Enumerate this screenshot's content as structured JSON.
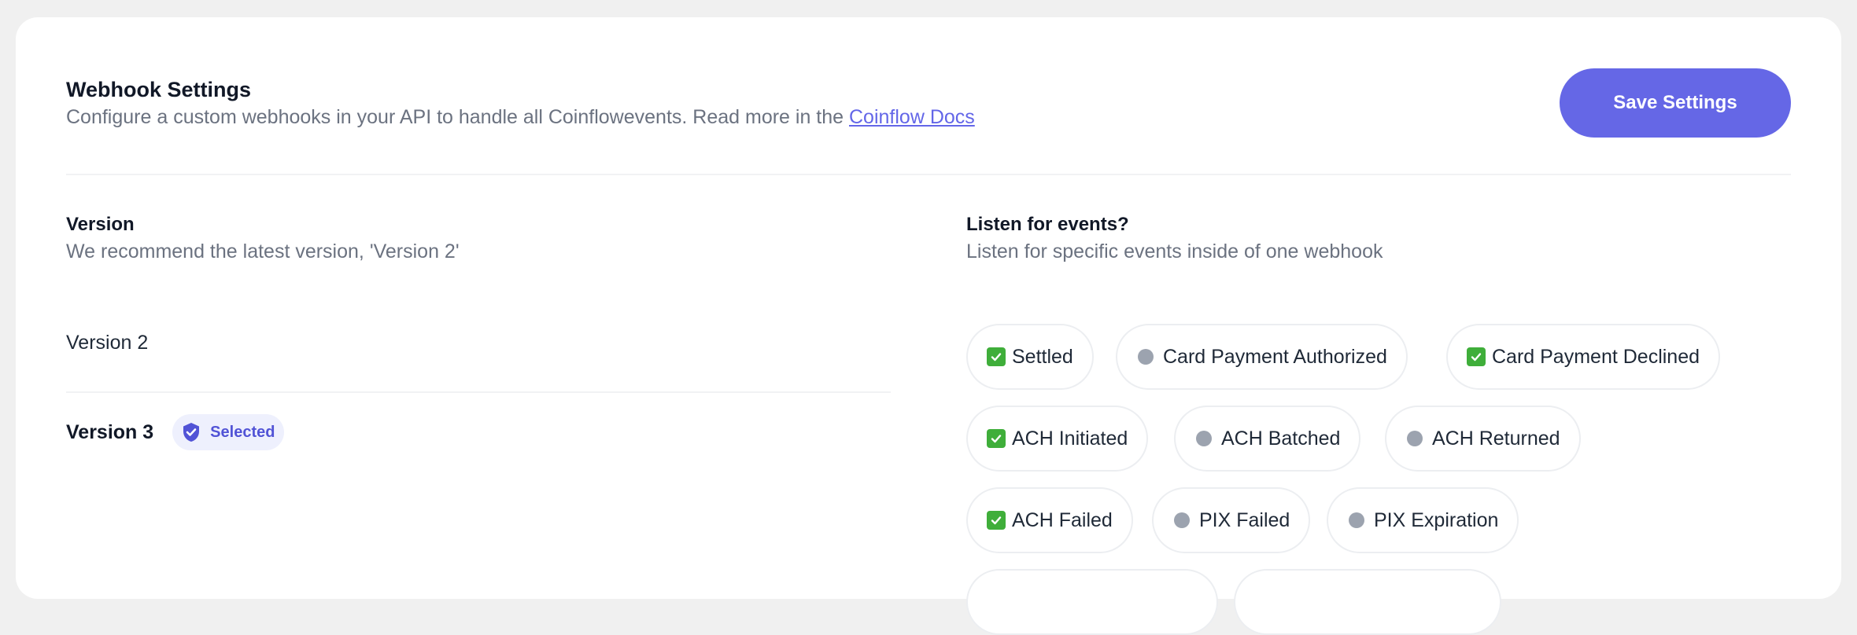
{
  "header": {
    "title": "Webhook Settings",
    "subtitle_text": "Configure a custom webhooks in your API to handle all Coinflowevents. Read more in the ",
    "docs_link": "Coinflow Docs",
    "save_label": "Save Settings"
  },
  "version_section": {
    "title": "Version",
    "subtitle": "We recommend the latest version, 'Version 2'",
    "versions": [
      {
        "label": "Version 2",
        "selected": false
      },
      {
        "label": "Version 3",
        "selected": true
      }
    ],
    "selected_label": "Selected"
  },
  "events_section": {
    "title": "Listen for events?",
    "subtitle": "Listen for specific events inside of one webhook",
    "events": [
      {
        "label": "Settled",
        "enabled": true
      },
      {
        "label": "Card Payment Authorized",
        "enabled": false
      },
      {
        "label": "Card Payment Declined",
        "enabled": true
      },
      {
        "label": "ACH Initiated",
        "enabled": true
      },
      {
        "label": "ACH Batched",
        "enabled": false
      },
      {
        "label": "ACH Returned",
        "enabled": false
      },
      {
        "label": "ACH Failed",
        "enabled": true
      },
      {
        "label": "PIX Failed",
        "enabled": false
      },
      {
        "label": "PIX Expiration",
        "enabled": false
      }
    ]
  },
  "colors": {
    "accent": "#6567e6",
    "enabled": "#3fae3a",
    "disabled": "#9ca3af",
    "badge_bg": "#eef0fd"
  }
}
